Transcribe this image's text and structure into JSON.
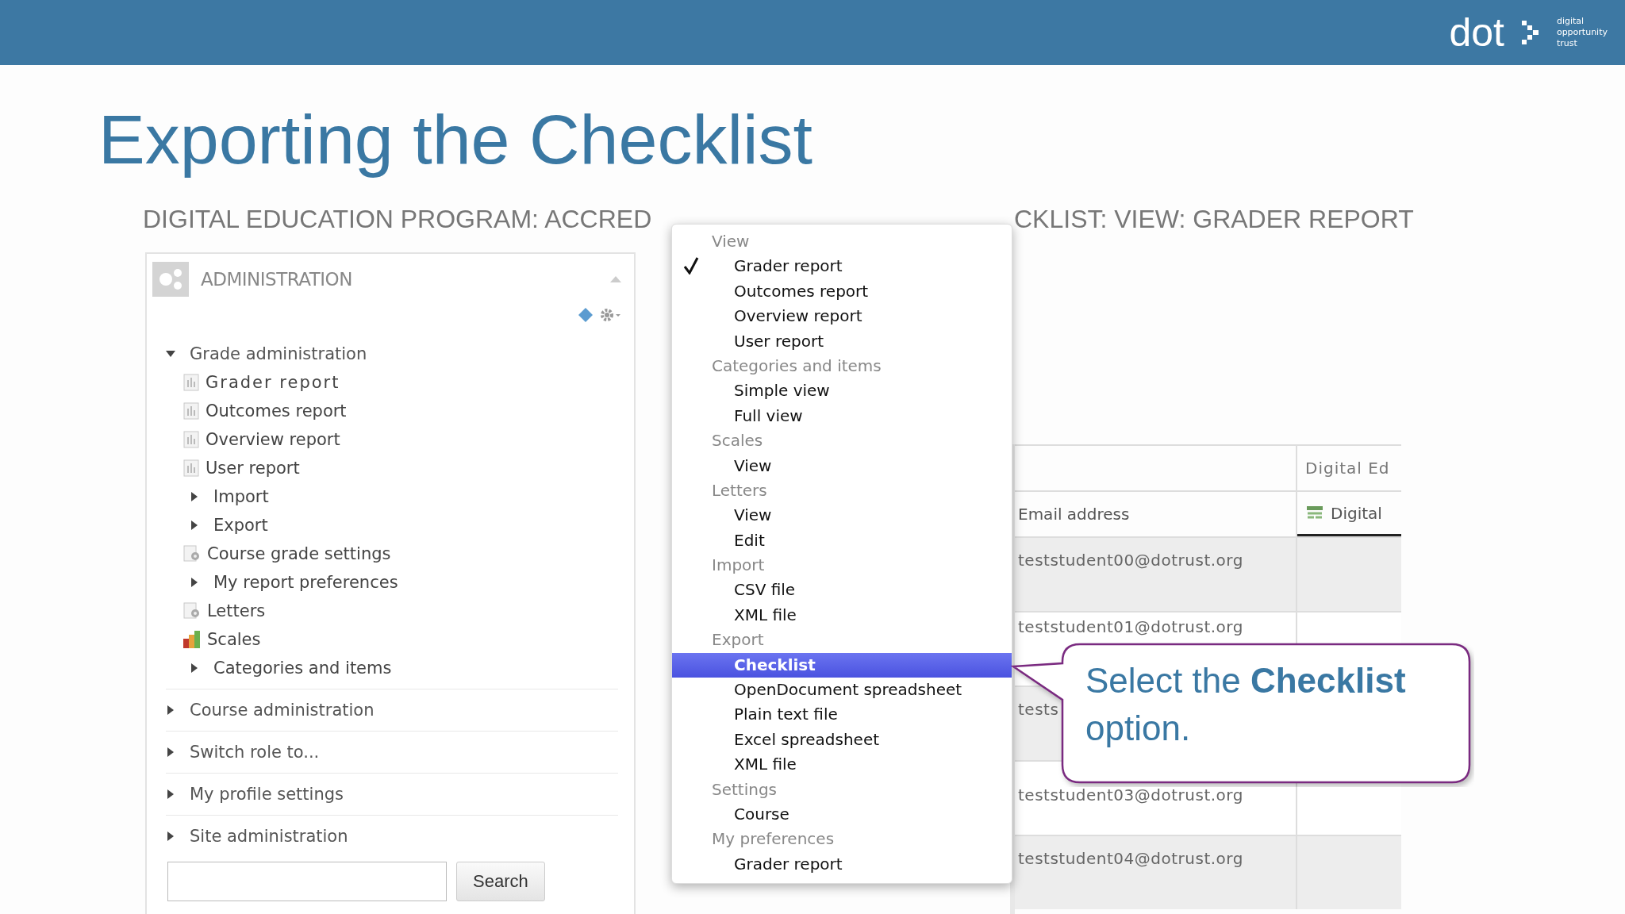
{
  "logo": {
    "name": "dot",
    "tagline": [
      "digital",
      "opportunity",
      "trust"
    ]
  },
  "title": "Exporting the Checklist",
  "page_heading": {
    "before_menu": "DIGITAL EDUCATION PROGRAM: ACCRED",
    "after_menu": "CKLIST: VIEW: GRADER REPORT"
  },
  "admin_block": {
    "title": "ADMINISTRATION",
    "tree": [
      {
        "label": "Grade administration",
        "kind": "branch",
        "expanded": true,
        "children": [
          {
            "label": "Grader report",
            "kind": "report"
          },
          {
            "label": "Outcomes report",
            "kind": "report"
          },
          {
            "label": "Overview report",
            "kind": "report"
          },
          {
            "label": "User report",
            "kind": "report"
          },
          {
            "label": "Import",
            "kind": "branch",
            "expanded": false
          },
          {
            "label": "Export",
            "kind": "branch",
            "expanded": false
          },
          {
            "label": "Course grade settings",
            "kind": "settings"
          },
          {
            "label": "My report preferences",
            "kind": "branch",
            "expanded": false
          },
          {
            "label": "Letters",
            "kind": "settings"
          },
          {
            "label": "Scales",
            "kind": "scales"
          },
          {
            "label": "Categories and items",
            "kind": "branch",
            "expanded": false
          }
        ]
      },
      {
        "label": "Course administration",
        "kind": "branch",
        "expanded": false
      },
      {
        "label": "Switch role to...",
        "kind": "branch",
        "expanded": false
      },
      {
        "label": "My profile settings",
        "kind": "branch",
        "expanded": false
      },
      {
        "label": "Site administration",
        "kind": "branch",
        "expanded": false
      }
    ],
    "search_button": "Search"
  },
  "report_menu": [
    {
      "label": "View",
      "kind": "header"
    },
    {
      "label": "Grader report",
      "kind": "option",
      "checked": true,
      "selected": false
    },
    {
      "label": "Outcomes report",
      "kind": "option",
      "checked": false,
      "selected": false
    },
    {
      "label": "Overview report",
      "kind": "option",
      "checked": false,
      "selected": false
    },
    {
      "label": "User report",
      "kind": "option",
      "checked": false,
      "selected": false
    },
    {
      "label": "Categories and items",
      "kind": "header"
    },
    {
      "label": "Simple view",
      "kind": "option",
      "checked": false,
      "selected": false
    },
    {
      "label": "Full view",
      "kind": "option",
      "checked": false,
      "selected": false
    },
    {
      "label": "Scales",
      "kind": "header"
    },
    {
      "label": "View",
      "kind": "option",
      "checked": false,
      "selected": false
    },
    {
      "label": "Letters",
      "kind": "header"
    },
    {
      "label": "View",
      "kind": "option",
      "checked": false,
      "selected": false
    },
    {
      "label": "Edit",
      "kind": "option",
      "checked": false,
      "selected": false
    },
    {
      "label": "Import",
      "kind": "header"
    },
    {
      "label": "CSV file",
      "kind": "option",
      "checked": false,
      "selected": false
    },
    {
      "label": "XML file",
      "kind": "option",
      "checked": false,
      "selected": false
    },
    {
      "label": "Export",
      "kind": "header"
    },
    {
      "label": "Checklist",
      "kind": "option",
      "checked": false,
      "selected": true
    },
    {
      "label": "OpenDocument spreadsheet",
      "kind": "option",
      "checked": false,
      "selected": false
    },
    {
      "label": "Plain text file",
      "kind": "option",
      "checked": false,
      "selected": false
    },
    {
      "label": "Excel spreadsheet",
      "kind": "option",
      "checked": false,
      "selected": false
    },
    {
      "label": "XML file",
      "kind": "option",
      "checked": false,
      "selected": false
    },
    {
      "label": "Settings",
      "kind": "header"
    },
    {
      "label": "Course",
      "kind": "option",
      "checked": false,
      "selected": false
    },
    {
      "label": "My preferences",
      "kind": "header"
    },
    {
      "label": "Grader report",
      "kind": "option",
      "checked": false,
      "selected": false
    }
  ],
  "grader_table": {
    "group_header": "Digital Ed",
    "columns": [
      "Email address",
      "Digital"
    ],
    "rows": [
      "teststudent00@dotrust.org",
      "teststudent01@dotrust.org",
      "tests",
      "teststudent03@dotrust.org",
      "teststudent04@dotrust.org"
    ]
  },
  "callout": "Select the **Checklist** option."
}
